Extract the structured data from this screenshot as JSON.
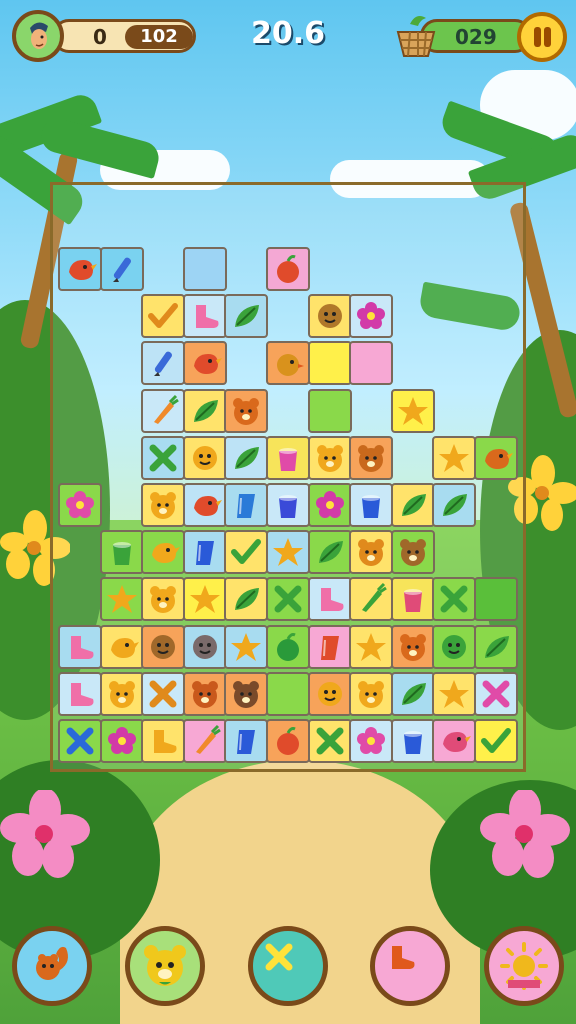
{
  "hud": {
    "score_left": "0",
    "score_total": "102",
    "timer": "20.6",
    "coins": "029",
    "icons": [
      "player-avatar-icon",
      "basket-icon",
      "pause-icon"
    ]
  },
  "board": {
    "tiles": [
      {
        "r": 0,
        "c": 0,
        "bg": "#7ad2f0",
        "fg": "#e04b2b",
        "shape": "bird"
      },
      {
        "r": 0,
        "c": 1,
        "bg": "#7ad2f0",
        "fg": "#3a6ad8",
        "shape": "pencil"
      },
      {
        "r": 0,
        "c": 3,
        "bg": "#9dd4f4",
        "fg": "#9dd4f4",
        "shape": "blank"
      },
      {
        "r": 0,
        "c": 5,
        "bg": "#f4a8d4",
        "fg": "#e04b2b",
        "shape": "apple"
      },
      {
        "r": 1,
        "c": 2,
        "bg": "#ffe36b",
        "fg": "#e08a1c",
        "shape": "check"
      },
      {
        "r": 1,
        "c": 3,
        "bg": "#c9e8f8",
        "fg": "#f06fa8",
        "shape": "boot"
      },
      {
        "r": 1,
        "c": 4,
        "bg": "#a8dcf0",
        "fg": "#3aa33a",
        "shape": "leaf"
      },
      {
        "r": 1,
        "c": 6,
        "bg": "#ffe36b",
        "fg": "#b0782a",
        "shape": "face"
      },
      {
        "r": 1,
        "c": 7,
        "bg": "#c9e8f8",
        "fg": "#d23aa8",
        "shape": "flower"
      },
      {
        "r": 2,
        "c": 2,
        "bg": "#bde3f6",
        "fg": "#3a6ad8",
        "shape": "pencil"
      },
      {
        "r": 2,
        "c": 3,
        "bg": "#f7a35a",
        "fg": "#e04b2b",
        "shape": "bird"
      },
      {
        "r": 2,
        "c": 5,
        "bg": "#f7a35a",
        "fg": "#d9921c",
        "shape": "chick"
      },
      {
        "r": 2,
        "c": 6,
        "bg": "#fff04a",
        "fg": "#fff04a",
        "shape": "blank"
      },
      {
        "r": 2,
        "c": 7,
        "bg": "#f7a8d4",
        "fg": "#f7a8d4",
        "shape": "blank"
      },
      {
        "r": 3,
        "c": 2,
        "bg": "#c9e8f8",
        "fg": "#f08a2a",
        "shape": "carrot"
      },
      {
        "r": 3,
        "c": 3,
        "bg": "#ffe36b",
        "fg": "#3aa33a",
        "shape": "leaf"
      },
      {
        "r": 3,
        "c": 4,
        "bg": "#f7a35a",
        "fg": "#d9691c",
        "shape": "bear"
      },
      {
        "r": 3,
        "c": 6,
        "bg": "#8ad94a",
        "fg": "#8ad94a",
        "shape": "blank"
      },
      {
        "r": 3,
        "c": 8,
        "bg": "#fff04a",
        "fg": "#f0a81c",
        "shape": "star"
      },
      {
        "r": 4,
        "c": 2,
        "bg": "#a8dcf0",
        "fg": "#3aa33a",
        "shape": "x"
      },
      {
        "r": 4,
        "c": 3,
        "bg": "#ffe36b",
        "fg": "#f0a81c",
        "shape": "face"
      },
      {
        "r": 4,
        "c": 4,
        "bg": "#bde3f6",
        "fg": "#3aa33a",
        "shape": "leaf"
      },
      {
        "r": 4,
        "c": 5,
        "bg": "#f7e45a",
        "fg": "#e04ba8",
        "shape": "bucket"
      },
      {
        "r": 4,
        "c": 6,
        "bg": "#ffe36b",
        "fg": "#f0a81c",
        "shape": "bear"
      },
      {
        "r": 4,
        "c": 7,
        "bg": "#f7a35a",
        "fg": "#c9691c",
        "shape": "bear"
      },
      {
        "r": 4,
        "c": 9,
        "bg": "#ffe36b",
        "fg": "#f0a81c",
        "shape": "star"
      },
      {
        "r": 4,
        "c": 10,
        "bg": "#8ad94a",
        "fg": "#d9691c",
        "shape": "bird"
      },
      {
        "r": 5,
        "c": 0,
        "bg": "#8ad94a",
        "fg": "#e04ba8",
        "shape": "flower"
      },
      {
        "r": 5,
        "c": 2,
        "bg": "#ffe36b",
        "fg": "#f0a81c",
        "shape": "bear"
      },
      {
        "r": 5,
        "c": 3,
        "bg": "#bde3f6",
        "fg": "#e04b2b",
        "shape": "bird"
      },
      {
        "r": 5,
        "c": 4,
        "bg": "#a8dcf0",
        "fg": "#2a7ad8",
        "shape": "cup"
      },
      {
        "r": 5,
        "c": 5,
        "bg": "#c9e8f8",
        "fg": "#3a4ad8",
        "shape": "bucket"
      },
      {
        "r": 5,
        "c": 6,
        "bg": "#8ad94a",
        "fg": "#d23aa8",
        "shape": "flower"
      },
      {
        "r": 5,
        "c": 7,
        "bg": "#c9e8f8",
        "fg": "#2a5ad8",
        "shape": "bucket"
      },
      {
        "r": 5,
        "c": 8,
        "bg": "#ffe36b",
        "fg": "#3aa33a",
        "shape": "leaf"
      },
      {
        "r": 5,
        "c": 9,
        "bg": "#a8dcf0",
        "fg": "#3aa33a",
        "shape": "leaf"
      },
      {
        "r": 6,
        "c": 1,
        "bg": "#8ad94a",
        "fg": "#3aa33a",
        "shape": "bucket"
      },
      {
        "r": 6,
        "c": 2,
        "bg": "#8ad94a",
        "fg": "#f0a81c",
        "shape": "bird"
      },
      {
        "r": 6,
        "c": 3,
        "bg": "#a8dcf0",
        "fg": "#2a5ad8",
        "shape": "cup"
      },
      {
        "r": 6,
        "c": 4,
        "bg": "#ffe36b",
        "fg": "#3aa33a",
        "shape": "check"
      },
      {
        "r": 6,
        "c": 5,
        "bg": "#a8dcf0",
        "fg": "#f0a81c",
        "shape": "star"
      },
      {
        "r": 6,
        "c": 6,
        "bg": "#8ad94a",
        "fg": "#3aa33a",
        "shape": "leaf"
      },
      {
        "r": 6,
        "c": 7,
        "bg": "#ffe36b",
        "fg": "#e08a1c",
        "shape": "bear"
      },
      {
        "r": 6,
        "c": 8,
        "bg": "#8ad94a",
        "fg": "#a0682a",
        "shape": "bear"
      },
      {
        "r": 7,
        "c": 1,
        "bg": "#8ad94a",
        "fg": "#f0a81c",
        "shape": "star"
      },
      {
        "r": 7,
        "c": 2,
        "bg": "#ffe36b",
        "fg": "#f0a81c",
        "shape": "bear"
      },
      {
        "r": 7,
        "c": 3,
        "bg": "#fff04a",
        "fg": "#f0a81c",
        "shape": "star"
      },
      {
        "r": 7,
        "c": 4,
        "bg": "#ffe36b",
        "fg": "#3aa33a",
        "shape": "leaf"
      },
      {
        "r": 7,
        "c": 5,
        "bg": "#8ad94a",
        "fg": "#3aa33a",
        "shape": "x"
      },
      {
        "r": 7,
        "c": 6,
        "bg": "#c9e8f8",
        "fg": "#f06fa8",
        "shape": "boot"
      },
      {
        "r": 7,
        "c": 7,
        "bg": "#ffe36b",
        "fg": "#3aa33a",
        "shape": "carrot"
      },
      {
        "r": 7,
        "c": 8,
        "bg": "#f7e45a",
        "fg": "#e04b78",
        "shape": "bucket"
      },
      {
        "r": 7,
        "c": 9,
        "bg": "#8ad94a",
        "fg": "#3aa33a",
        "shape": "x"
      },
      {
        "r": 7,
        "c": 10,
        "bg": "#5abf3a",
        "fg": "#5abf3a",
        "shape": "blank"
      },
      {
        "r": 8,
        "c": 0,
        "bg": "#a8dcf0",
        "fg": "#f06fa8",
        "shape": "boot"
      },
      {
        "r": 8,
        "c": 1,
        "bg": "#ffe36b",
        "fg": "#f0a81c",
        "shape": "bird"
      },
      {
        "r": 8,
        "c": 2,
        "bg": "#f7a35a",
        "fg": "#a0682a",
        "shape": "face"
      },
      {
        "r": 8,
        "c": 3,
        "bg": "#a8dcf0",
        "fg": "#7a6a6a",
        "shape": "face"
      },
      {
        "r": 8,
        "c": 4,
        "bg": "#a8dcf0",
        "fg": "#f0a81c",
        "shape": "star"
      },
      {
        "r": 8,
        "c": 5,
        "bg": "#8ad94a",
        "fg": "#2a9a3a",
        "shape": "apple"
      },
      {
        "r": 8,
        "c": 6,
        "bg": "#f7a8d4",
        "fg": "#e04b2b",
        "shape": "cup"
      },
      {
        "r": 8,
        "c": 7,
        "bg": "#ffe36b",
        "fg": "#f0a81c",
        "shape": "star"
      },
      {
        "r": 8,
        "c": 8,
        "bg": "#f7a35a",
        "fg": "#d9691c",
        "shape": "bear"
      },
      {
        "r": 8,
        "c": 9,
        "bg": "#8ad94a",
        "fg": "#3aa33a",
        "shape": "face"
      },
      {
        "r": 8,
        "c": 10,
        "bg": "#8ad94a",
        "fg": "#3aa33a",
        "shape": "leaf"
      },
      {
        "r": 9,
        "c": 0,
        "bg": "#c9e8f8",
        "fg": "#f06fa8",
        "shape": "boot"
      },
      {
        "r": 9,
        "c": 1,
        "bg": "#ffe36b",
        "fg": "#f0a81c",
        "shape": "bear"
      },
      {
        "r": 9,
        "c": 2,
        "bg": "#c9e8f8",
        "fg": "#e08a1c",
        "shape": "x"
      },
      {
        "r": 9,
        "c": 3,
        "bg": "#f7a35a",
        "fg": "#c9591c",
        "shape": "bear"
      },
      {
        "r": 9,
        "c": 4,
        "bg": "#f7a35a",
        "fg": "#7a4a2a",
        "shape": "bear"
      },
      {
        "r": 9,
        "c": 5,
        "bg": "#8ad94a",
        "fg": "#8ad94a",
        "shape": "blank"
      },
      {
        "r": 9,
        "c": 6,
        "bg": "#f7a35a",
        "fg": "#f0a81c",
        "shape": "face"
      },
      {
        "r": 9,
        "c": 7,
        "bg": "#ffe36b",
        "fg": "#f0a81c",
        "shape": "bear"
      },
      {
        "r": 9,
        "c": 8,
        "bg": "#a8dcf0",
        "fg": "#3aa33a",
        "shape": "leaf"
      },
      {
        "r": 9,
        "c": 9,
        "bg": "#ffe36b",
        "fg": "#f0a81c",
        "shape": "star"
      },
      {
        "r": 9,
        "c": 10,
        "bg": "#c9e8f8",
        "fg": "#e04ba8",
        "shape": "x"
      },
      {
        "r": 10,
        "c": 0,
        "bg": "#8ad94a",
        "fg": "#2a6ad8",
        "shape": "x"
      },
      {
        "r": 10,
        "c": 1,
        "bg": "#8ad94a",
        "fg": "#d23aa8",
        "shape": "flower"
      },
      {
        "r": 10,
        "c": 2,
        "bg": "#ffe36b",
        "fg": "#f0a81c",
        "shape": "boot"
      },
      {
        "r": 10,
        "c": 3,
        "bg": "#f7a8d4",
        "fg": "#f08a2a",
        "shape": "carrot"
      },
      {
        "r": 10,
        "c": 4,
        "bg": "#a8dcf0",
        "fg": "#2a5ad8",
        "shape": "cup"
      },
      {
        "r": 10,
        "c": 5,
        "bg": "#f7a35a",
        "fg": "#e04b2b",
        "shape": "apple"
      },
      {
        "r": 10,
        "c": 6,
        "bg": "#ffe36b",
        "fg": "#3aa33a",
        "shape": "x"
      },
      {
        "r": 10,
        "c": 7,
        "bg": "#c9e8f8",
        "fg": "#e04ba8",
        "shape": "flower"
      },
      {
        "r": 10,
        "c": 8,
        "bg": "#c9e8f8",
        "fg": "#2a5ad8",
        "shape": "bucket"
      },
      {
        "r": 10,
        "c": 9,
        "bg": "#f7a8d4",
        "fg": "#e04b78",
        "shape": "bird"
      },
      {
        "r": 10,
        "c": 10,
        "bg": "#fff04a",
        "fg": "#3aa33a",
        "shape": "check"
      }
    ]
  },
  "powerups": [
    {
      "name": "powerup-squirrel",
      "icon": "squirrel-icon",
      "bg": "#7ad2f0",
      "fg": "#d9691c",
      "shape": "squirrel"
    },
    {
      "name": "powerup-bear",
      "icon": "bear-face-icon",
      "bg": "#a8e07a",
      "fg": "#f0c81c",
      "shape": "bearface"
    },
    {
      "name": "powerup-shuffle",
      "icon": "x-icon",
      "bg": "#4fc9b8",
      "fg": "#ffe23a",
      "shape": "x"
    },
    {
      "name": "powerup-boot",
      "icon": "boot-icon",
      "bg": "#f7a8d4",
      "fg": "#e0591c",
      "shape": "boot"
    },
    {
      "name": "powerup-sun",
      "icon": "sun-icon",
      "bg": "#f7a8d4",
      "fg": "#f0b81c",
      "shape": "sun"
    }
  ]
}
